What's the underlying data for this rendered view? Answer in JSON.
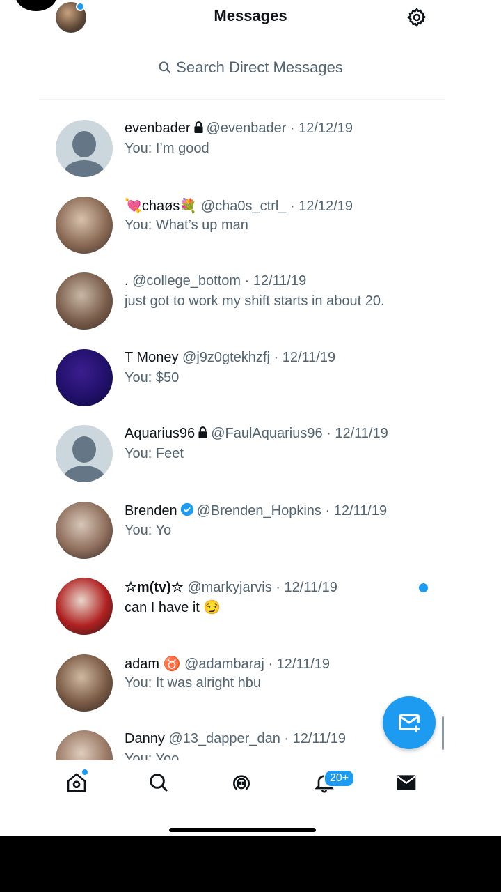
{
  "header": {
    "title": "Messages",
    "search_placeholder": "Search Direct Messages"
  },
  "conversations": [
    {
      "name": "evenbader",
      "handle": "@evenbader",
      "date": "· 12/12/19",
      "preview": "You: I’m good",
      "lock": true,
      "verified": false,
      "unread": false,
      "avatar": "default-avatar"
    },
    {
      "name": "💘chaøs💐",
      "handle": "@cha0s_ctrl_",
      "date": "· 12/12/19",
      "preview": "You: What’s up man",
      "lock": false,
      "verified": false,
      "unread": false,
      "avatar": "photo-avatar"
    },
    {
      "name": ".",
      "handle": "@college_bottom",
      "date": "· 12/11/19",
      "preview": "just got to work my shift starts in about 20.",
      "lock": false,
      "verified": false,
      "unread": false,
      "avatar": "photo-avatar"
    },
    {
      "name": "T Money",
      "handle": "@j9z0gtekhzfj",
      "date": "· 12/11/19",
      "preview": "You: $50",
      "lock": false,
      "verified": false,
      "unread": false,
      "avatar": "photo-avatar"
    },
    {
      "name": "Aquarius96",
      "handle": "@FaulAquarius96",
      "date": "· 12/11/19",
      "preview": "You: Feet",
      "lock": true,
      "verified": false,
      "unread": false,
      "avatar": "default-avatar"
    },
    {
      "name": "Brenden",
      "handle": "@Brenden_Hopkins",
      "date": "· 12/11/19",
      "preview": "You: Yo",
      "lock": false,
      "verified": true,
      "unread": false,
      "avatar": "photo-avatar"
    },
    {
      "name": "☆m(tv)☆",
      "handle": "@markyjarvis",
      "date": "· 12/11/19",
      "preview": "can I have it 😏",
      "lock": false,
      "verified": false,
      "unread": true,
      "avatar": "photo-avatar"
    },
    {
      "name": "adam ♉",
      "handle": "@adambaraj",
      "date": "· 12/11/19",
      "preview": "You: It was alright hbu",
      "lock": false,
      "verified": false,
      "unread": false,
      "avatar": "photo-avatar"
    },
    {
      "name": "Danny",
      "handle": "@13_dapper_dan",
      "date": "· 12/11/19",
      "preview": "You: Yoo",
      "lock": false,
      "verified": false,
      "unread": false,
      "avatar": "photo-avatar"
    }
  ],
  "tabbar": {
    "items": [
      "home-icon",
      "search-icon",
      "spaces-icon",
      "notifications-icon",
      "messages-icon"
    ],
    "notifications_badge": "20+"
  },
  "colors": {
    "accent": "#1d9bf0",
    "text_primary": "#0f1419",
    "text_secondary": "#536471"
  }
}
